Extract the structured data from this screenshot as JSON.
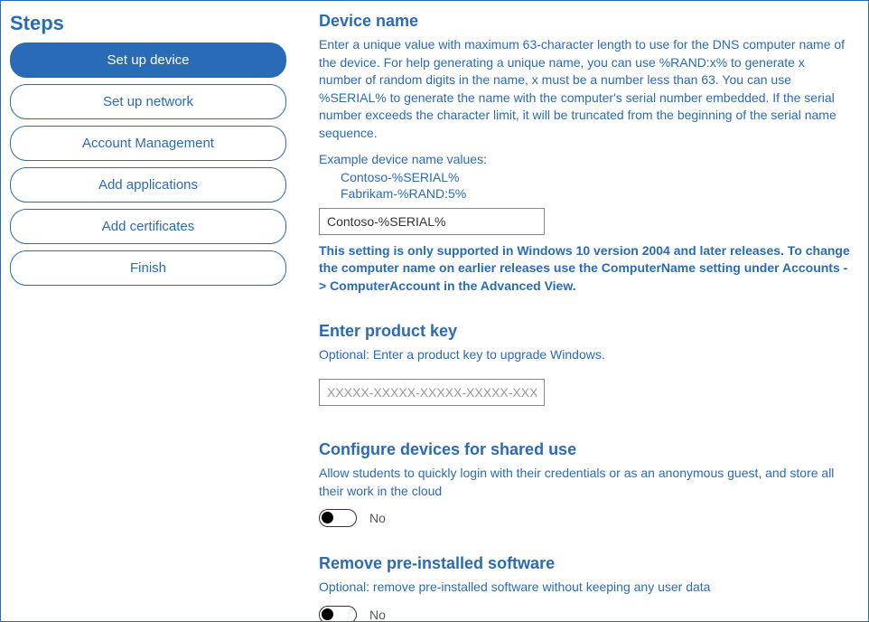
{
  "sidebar": {
    "title": "Steps",
    "items": [
      {
        "label": "Set up device",
        "active": true
      },
      {
        "label": "Set up network",
        "active": false
      },
      {
        "label": "Account Management",
        "active": false
      },
      {
        "label": "Add applications",
        "active": false
      },
      {
        "label": "Add certificates",
        "active": false
      },
      {
        "label": "Finish",
        "active": false
      }
    ]
  },
  "device_name": {
    "title": "Device name",
    "desc": "Enter a unique value with maximum 63-character length to use for the DNS computer name of the device. For help generating a unique name, you can use %RAND:x% to generate x number of random digits in the name, x must be a number less than 63. You can use %SERIAL% to generate the name with the computer's serial number embedded. If the serial number exceeds the character limit, it will be truncated from the beginning of the serial name sequence.",
    "example_label": "Example device name values:",
    "examples": [
      "Contoso-%SERIAL%",
      "Fabrikam-%RAND:5%"
    ],
    "input_value": "Contoso-%SERIAL%",
    "note": "This setting is only supported in Windows 10 version 2004 and later releases. To change the computer name on earlier releases use the ComputerName setting under Accounts -> ComputerAccount in the Advanced View."
  },
  "product_key": {
    "title": "Enter product key",
    "desc": "Optional: Enter a product key to upgrade Windows.",
    "placeholder": "XXXXX-XXXXX-XXXXX-XXXXX-XXXXX",
    "value": ""
  },
  "shared_use": {
    "title": "Configure devices for shared use",
    "desc": "Allow students to quickly login with their credentials or as an anonymous guest, and store all their work in the cloud",
    "toggle_label": "No"
  },
  "remove_software": {
    "title": "Remove pre-installed software",
    "desc": "Optional: remove pre-installed software without keeping any user data",
    "toggle_label": "No"
  }
}
